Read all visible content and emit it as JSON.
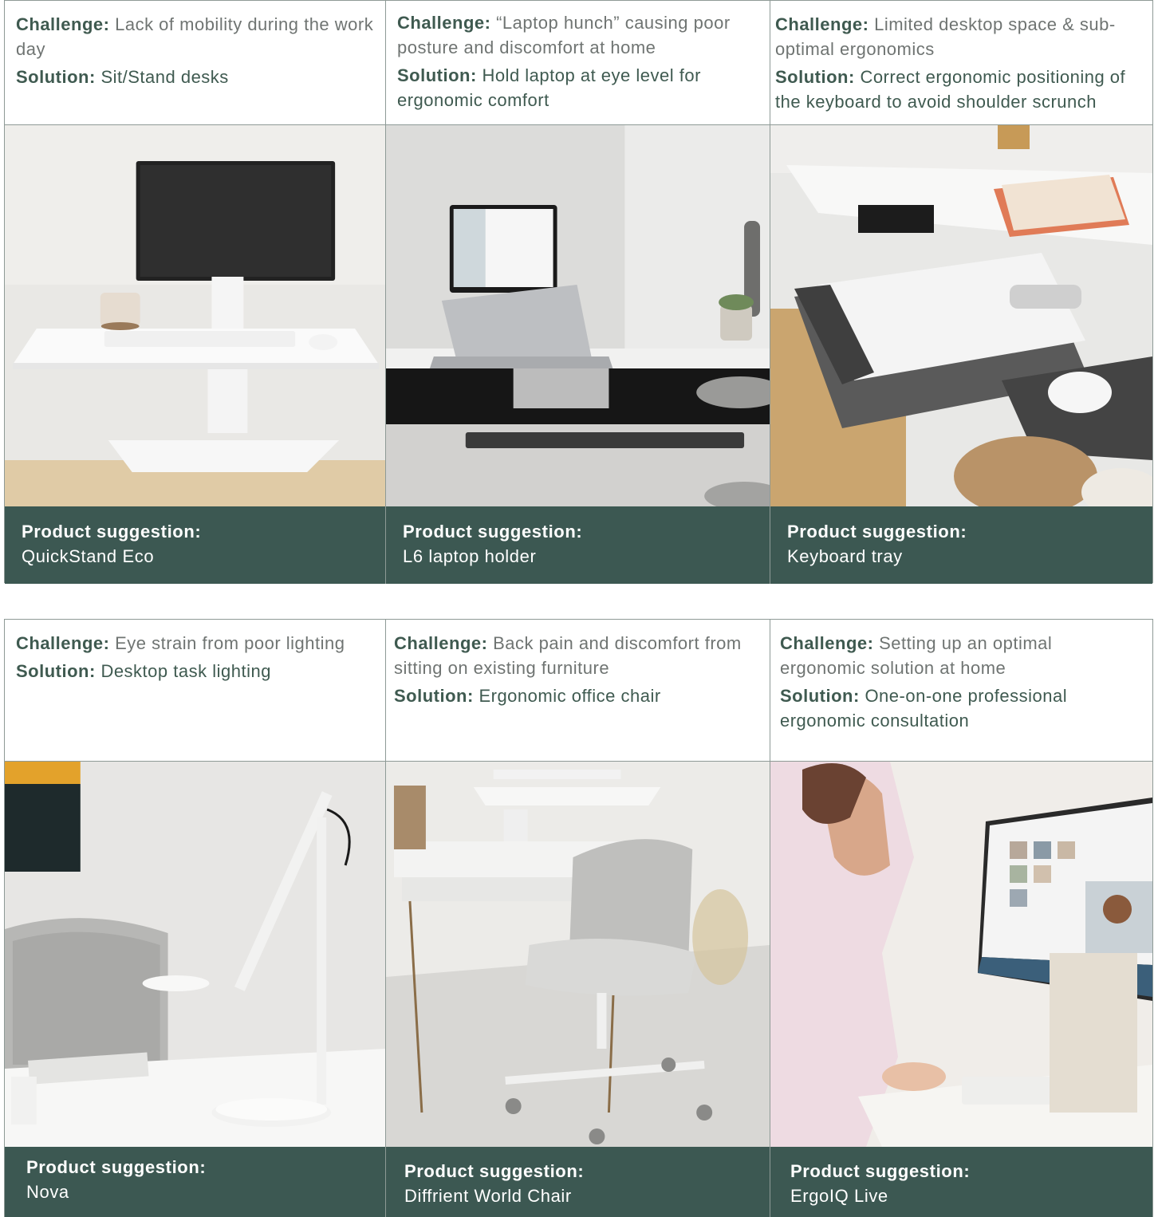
{
  "labels": {
    "challenge": "Challenge:",
    "solution": "Solution:",
    "product": "Product suggestion:"
  },
  "rows": [
    {
      "cards": [
        {
          "challenge": "Lack of mobility during the work day",
          "solution": "Sit/Stand desks",
          "product": "QuickStand Eco",
          "image_icon": "sit-stand-converter-photo"
        },
        {
          "challenge": "“Laptop hunch” causing poor posture and discomfort at home",
          "solution": "Hold laptop at eye level for ergonomic comfort",
          "product": "L6 laptop holder",
          "image_icon": "laptop-holder-photo"
        },
        {
          "challenge": "Limited desktop space & sub-optimal ergonomics",
          "solution": "Correct ergonomic positioning of the keyboard to avoid shoulder scrunch",
          "product": "Keyboard tray",
          "image_icon": "keyboard-tray-photo"
        }
      ]
    },
    {
      "cards": [
        {
          "challenge": "Eye strain from poor lighting",
          "solution": "Desktop task lighting",
          "product": "Nova",
          "image_icon": "desk-lamp-photo"
        },
        {
          "challenge": "Back pain and discomfort from sitting on existing furniture",
          "solution": "Ergonomic office chair",
          "product": "Diffrient World Chair",
          "image_icon": "office-chair-photo"
        },
        {
          "challenge": "Setting up an optimal ergonomic solution at home",
          "solution": "One-on-one professional ergonomic consultation",
          "product": "ErgoIQ Live",
          "image_icon": "video-consultation-photo"
        }
      ]
    }
  ],
  "colors": {
    "accent_green": "#3c5852",
    "label_text": "#3f5a50",
    "body_text": "#6f7472",
    "border": "#8e9a96"
  }
}
